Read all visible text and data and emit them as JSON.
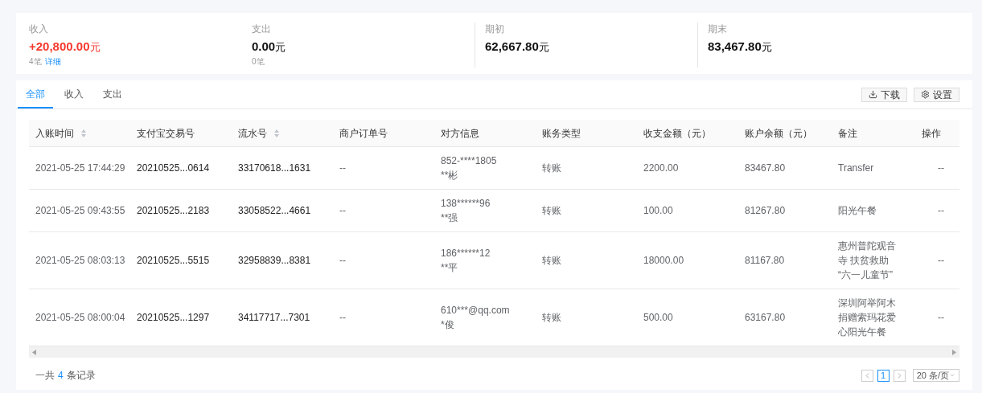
{
  "summary": [
    {
      "label": "收入",
      "value": "+20,800.00",
      "unit": "元",
      "kind": "income",
      "count": "4笔",
      "link": "详细"
    },
    {
      "label": "支出",
      "value": "0.00",
      "unit": "元",
      "kind": "plain",
      "count": "0笔"
    },
    {
      "label": "期初",
      "value": "62,667.80",
      "unit": "元",
      "kind": "plain"
    },
    {
      "label": "期末",
      "value": "83,467.80",
      "unit": "元",
      "kind": "plain"
    }
  ],
  "tabs": [
    {
      "label": "全部",
      "selected": true
    },
    {
      "label": "收入",
      "selected": false
    },
    {
      "label": "支出",
      "selected": false
    }
  ],
  "toolbar": [
    {
      "label": "下载",
      "kind": "download"
    },
    {
      "label": "设置",
      "kind": "settings"
    }
  ],
  "table": {
    "columns": [
      {
        "label": "入账时间",
        "sortable": true
      },
      {
        "label": "支付宝交易号",
        "sortable": false
      },
      {
        "label": "流水号",
        "sortable": true
      },
      {
        "label": "商户订单号",
        "sortable": false
      },
      {
        "label": "对方信息",
        "sortable": false
      },
      {
        "label": "账务类型",
        "sortable": false
      },
      {
        "label": "收支金额（元）",
        "sortable": false
      },
      {
        "label": "账户余额（元）",
        "sortable": false
      },
      {
        "label": "备注",
        "sortable": false
      },
      {
        "label": "操作",
        "sortable": false
      }
    ],
    "rows": [
      {
        "time": "2021-05-25 17:44:29",
        "trade_no": "20210525...0614",
        "serial": "33170618...1631",
        "order": "--",
        "party": [
          "852-****1805",
          "**彬"
        ],
        "type": "转账",
        "amount": "2200.00",
        "balance": "83467.80",
        "note": [
          "Transfer"
        ],
        "action": "--"
      },
      {
        "time": "2021-05-25 09:43:55",
        "trade_no": "20210525...2183",
        "serial": "33058522...4661",
        "order": "--",
        "party": [
          "138******96",
          "**强"
        ],
        "type": "转账",
        "amount": "100.00",
        "balance": "81267.80",
        "note": [
          "阳光午餐"
        ],
        "action": "--"
      },
      {
        "time": "2021-05-25 08:03:13",
        "trade_no": "20210525...5515",
        "serial": "32958839...8381",
        "order": "--",
        "party": [
          "186******12",
          "**平"
        ],
        "type": "转账",
        "amount": "18000.00",
        "balance": "81167.80",
        "note": [
          "惠州普陀观音",
          "寺 扶贫救助",
          "“六一儿童节”"
        ],
        "action": "--"
      },
      {
        "time": "2021-05-25 08:00:04",
        "trade_no": "20210525...1297",
        "serial": "34117717...7301",
        "order": "--",
        "party": [
          "610***@qq.com",
          "*俊"
        ],
        "type": "转账",
        "amount": "500.00",
        "balance": "63167.80",
        "note": [
          "深圳阿举阿木",
          "捐赠索玛花爱",
          "心阳光午餐"
        ],
        "action": "--"
      }
    ]
  },
  "footer": {
    "total_prefix": "一共",
    "total_count": "4",
    "total_suffix": "条记录",
    "pages": [
      {
        "label": "1",
        "selected": true
      }
    ],
    "page_size": "20 条/页"
  }
}
